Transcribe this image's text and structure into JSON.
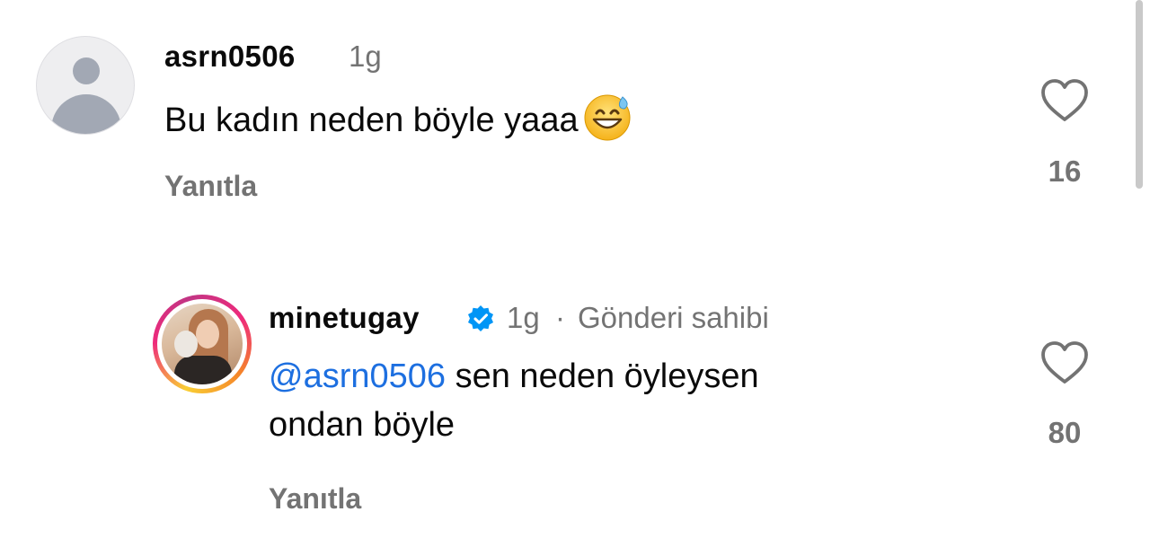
{
  "comments": [
    {
      "username": "asrn0506",
      "time": "1g",
      "text": "Bu kadın neden böyle yaaa",
      "emoji": "grinning-face-with-sweat",
      "reply_label": "Yanıtla",
      "like_count": "16"
    },
    {
      "username": "minetugay",
      "verified": true,
      "time": "1g",
      "separator": "·",
      "owner_label": "Gönderi sahibi",
      "mention": "@asrn0506",
      "text_line1": " sen neden öyleysen",
      "text_line2": "ondan böyle",
      "reply_label": "Yanıtla",
      "like_count": "80"
    }
  ],
  "colors": {
    "mention": "#1d6fe0",
    "verified": "#0095f6",
    "muted": "#737373"
  }
}
